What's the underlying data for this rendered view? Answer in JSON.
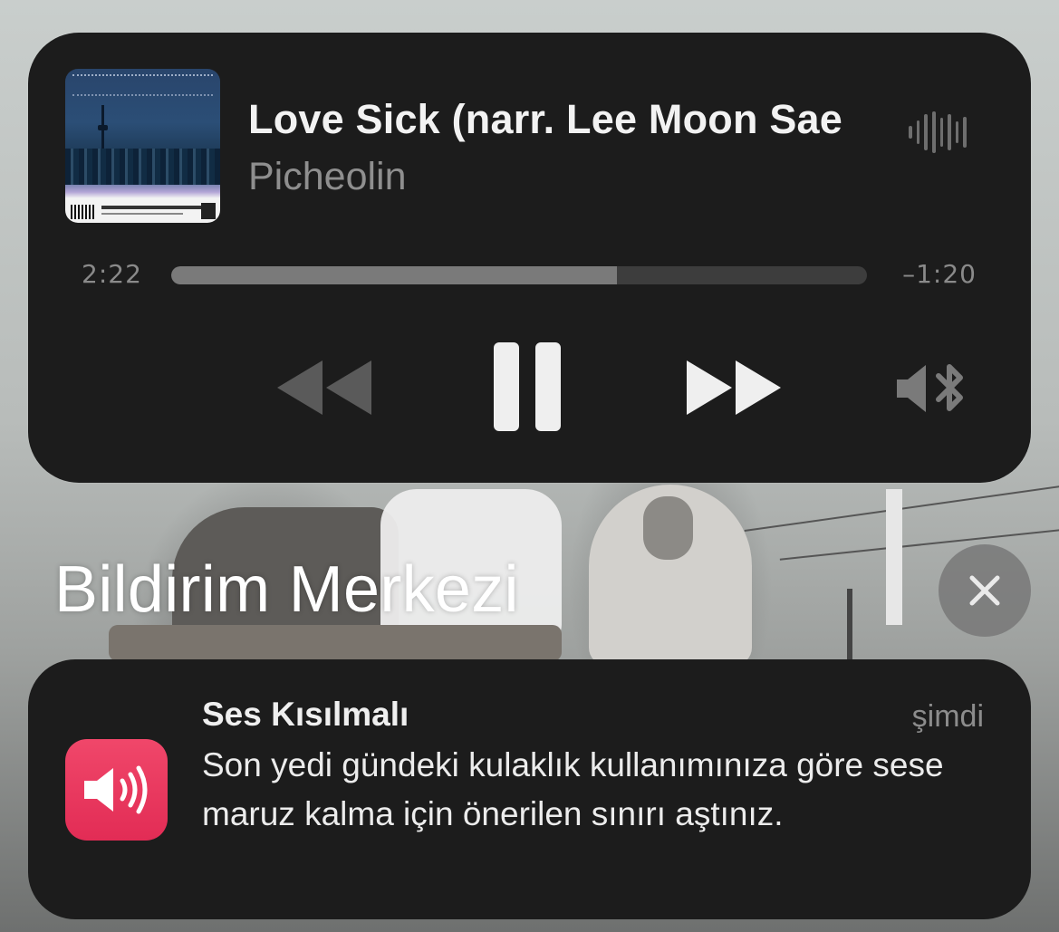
{
  "now_playing": {
    "title": "Love Sick (narr. Lee Moon Sae",
    "artist": "Picheolin",
    "elapsed": "2:22",
    "remaining": "–1:20",
    "progress_fraction": 0.64,
    "controls": {
      "rewind_icon": "rewind-icon",
      "pause_icon": "pause-icon",
      "forward_icon": "fast-forward-icon",
      "output_icon": "bluetooth-speaker-icon"
    },
    "waveform_icon": "audio-waveform-icon"
  },
  "notification_center": {
    "title": "Bildirim Merkezi",
    "close_icon": "close-icon"
  },
  "notification": {
    "app_icon": "speaker-volume-icon",
    "title": "Ses Kısılmalı",
    "time": "şimdi",
    "body": "Son yedi gündeki kulaklık kullanımınıza göre sese maruz kalma için önerilen sınırı aştınız."
  },
  "colors": {
    "card_background": "#1c1c1c",
    "notification_icon": "#e8385e",
    "secondary_text": "#8f8f8f"
  }
}
